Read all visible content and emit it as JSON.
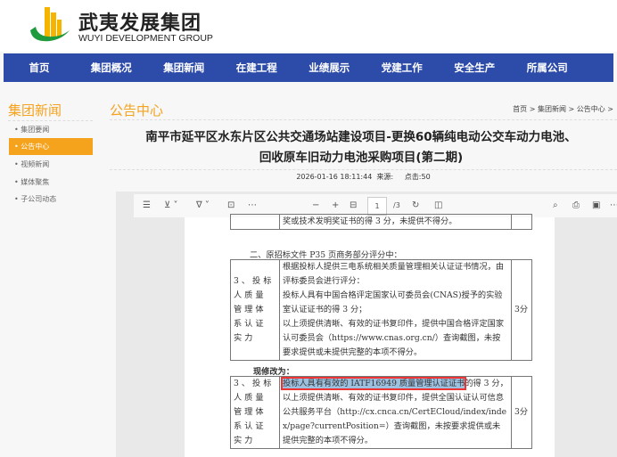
{
  "brand": {
    "name_cn": "武夷发展集团",
    "name_en": "WUYI DEVELOPMENT GROUP"
  },
  "nav": [
    "首页",
    "集团概况",
    "集团新闻",
    "在建工程",
    "业绩展示",
    "党建工作",
    "安全生产",
    "所属公司"
  ],
  "sidebar": {
    "title": "集团新闻",
    "items": [
      "集团要闻",
      "公告中心",
      "视频新闻",
      "媒体聚焦",
      "子公司动态"
    ],
    "active": 1
  },
  "main": {
    "section_title": "公告中心",
    "breadcrumb": "首页 > 集团新闻 > 公告中心 >",
    "article_title": "南平市延平区水东片区公共交通场站建设项目-更换60辆纯电动公交车动力电池、回收原车旧动力电池采购项目(第二期)",
    "date": "2026-01-16 18:11:44",
    "source_label": "来源:",
    "clicks_label": "点击:",
    "clicks": "50"
  },
  "pdf": {
    "page": "1",
    "total": "/3",
    "top_row": "奖或技术发明奖证书的得 3 分，未提供不得分。",
    "heading2": "二、原招标文件 P35 页商务部分评分中：",
    "row_label": "3、投标人质量管理体系认证实力",
    "row1_text": [
      "根据投标人提供三电系统相关质量管理相关认证证书情况，由评标委员会进行评分：",
      "投标人具有中国合格评定国家认可委员会(CNAS)授予的实验室认证证书的得 3 分；",
      "以上须提供清晰、有效的证书复印件，提供中国合格评定国家认可委员会（https://www.cnas.org.cn/）查询截图，未按要求提供或未提供完整的本项不得分。"
    ],
    "score": "3分",
    "changed_label": "现修改为：",
    "row2_highlight": "投标人具有有效的 IATF16949 质量管理认证证书",
    "row2_rest": "的得 3 分，以上须提供清晰、有效的证书复印件，提供全国认证认可信息公共服务平台（http://cx.cnca.cn/CertECloud/index/index/page?currentPosition=）查询截图，未按要求提供或未提供完整的本项不得分。"
  }
}
